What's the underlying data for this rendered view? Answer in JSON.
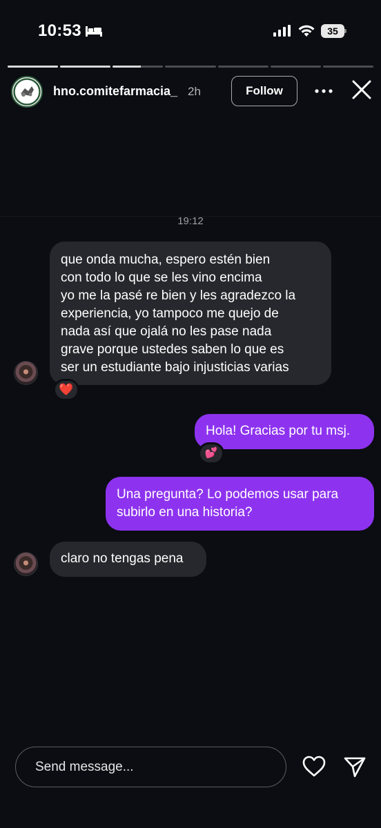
{
  "status_bar": {
    "time": "10:53",
    "battery": "35",
    "icons": [
      "bed-icon",
      "signal-icon",
      "wifi-icon",
      "battery-icon"
    ]
  },
  "story": {
    "segments_total": 7,
    "segments_complete": 2,
    "current_segment_progress": 0.55
  },
  "header": {
    "username": "hno.comitefarmacia_",
    "time_ago": "2h",
    "follow_label": "Follow",
    "icons": [
      "more-icon",
      "close-icon"
    ]
  },
  "conversation": {
    "timestamp": "19:12",
    "messages": [
      {
        "direction": "incoming",
        "text": "que onda mucha, espero estén bien\ncon todo lo que se les vino encima\nyo me la pasé re bien y les agradezco la\nexperiencia, yo tampoco me quejo de\nnada así que ojalá no les pase nada\ngrave porque ustedes saben lo que es\nser un estudiante bajo injusticias varias",
        "reaction": "❤️"
      },
      {
        "direction": "outgoing",
        "text": "Hola! Gracias por tu msj.",
        "reaction": "💕"
      },
      {
        "direction": "outgoing",
        "text": "Una pregunta? Lo podemos usar para\nsubirlo en una historia?"
      },
      {
        "direction": "incoming",
        "text": "claro no tengas pena"
      }
    ]
  },
  "composer": {
    "placeholder": "Send message...",
    "icons": [
      "heart-icon",
      "send-icon"
    ]
  },
  "colors": {
    "background": "#0b0d12",
    "incoming_bubble": "#26282d",
    "outgoing_bubble": "#8d33ef"
  }
}
